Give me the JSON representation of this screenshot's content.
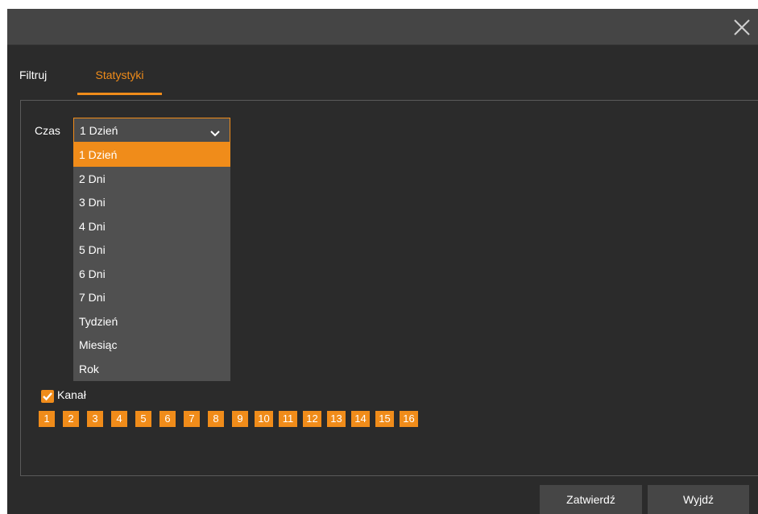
{
  "icons": {
    "close": "close-icon",
    "chevron": "chevron-down-icon",
    "check": "checkmark-icon"
  },
  "colors": {
    "accent": "#f08c1a",
    "background": "#2b2b2b",
    "titlebar": "#454545"
  },
  "tabs": [
    {
      "label": "Filtruj",
      "active": false
    },
    {
      "label": "Statystyki",
      "active": true
    }
  ],
  "czas": {
    "label": "Czas",
    "selected": "1 Dzień",
    "options": [
      "1 Dzień",
      "2 Dni",
      "3 Dni",
      "4 Dni",
      "5 Dni",
      "6 Dni",
      "7 Dni",
      "Tydzień",
      "Miesiąc",
      "Rok"
    ]
  },
  "kanal": {
    "label": "Kanał",
    "checked": true,
    "channels": [
      "1",
      "2",
      "3",
      "4",
      "5",
      "6",
      "7",
      "8",
      "9",
      "10",
      "11",
      "12",
      "13",
      "14",
      "15",
      "16"
    ]
  },
  "buttons": {
    "confirm": "Zatwierdź",
    "exit": "Wyjdź"
  }
}
